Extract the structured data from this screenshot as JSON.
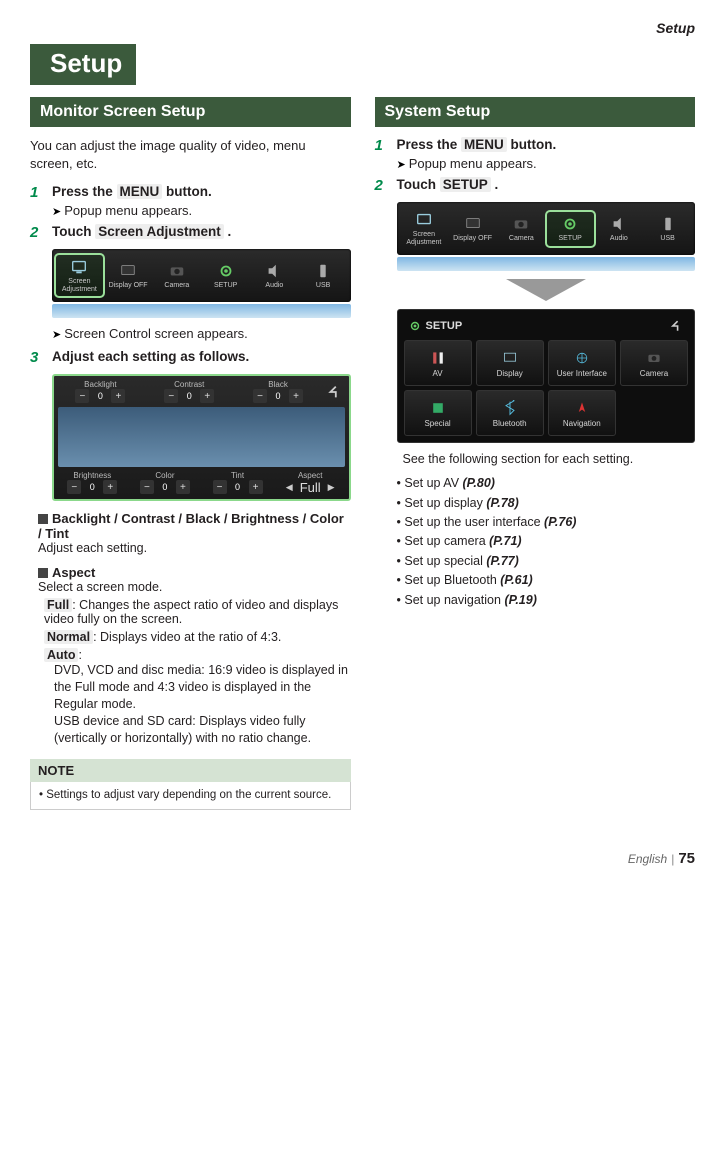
{
  "header": {
    "section": "Setup"
  },
  "title": "Setup",
  "monitor": {
    "heading": "Monitor Screen Setup",
    "intro": "You can adjust the image quality of video, menu screen, etc.",
    "step1": {
      "num": "1",
      "text_a": "Press the ",
      "btn": "MENU",
      "text_b": " button.",
      "sub": "Popup menu appears."
    },
    "step2": {
      "num": "2",
      "text_a": "Touch ",
      "btn": "Screen Adjustment",
      "text_b": " .",
      "sub": "Screen Control screen appears."
    },
    "step3": {
      "num": "3",
      "text": "Adjust each setting as follows."
    },
    "popup_tiles": [
      {
        "label": "Screen Adjustment"
      },
      {
        "label": "Display OFF"
      },
      {
        "label": "Camera"
      },
      {
        "label": "SETUP"
      },
      {
        "label": "Audio"
      },
      {
        "label": "USB"
      }
    ],
    "adjust": {
      "top": [
        {
          "label": "Backlight",
          "val": "0"
        },
        {
          "label": "Contrast",
          "val": "0"
        },
        {
          "label": "Black",
          "val": "0"
        }
      ],
      "bottom": [
        {
          "label": "Brightness",
          "val": "0"
        },
        {
          "label": "Color",
          "val": "0"
        },
        {
          "label": "Tint",
          "val": "0"
        }
      ],
      "aspect_label": "Aspect",
      "aspect_value": "Full"
    },
    "group1": {
      "items": "Backlight / Contrast / Black / Brightness / Color / Tint",
      "desc": "Adjust each setting."
    },
    "group2": {
      "title": "Aspect",
      "desc": "Select a screen mode.",
      "full": {
        "name": "Full",
        "desc": ": Changes the aspect ratio of video and displays video fully on the screen."
      },
      "normal": {
        "name": "Normal",
        "desc": ": Displays video at the ratio of 4:3."
      },
      "auto": {
        "name": "Auto",
        "colon": ":",
        "d1": "DVD, VCD and disc media: 16:9 video is displayed in the Full mode and 4:3 video is displayed in the Regular mode.",
        "d2": "USB device and SD card: Displays video fully (vertically or horizontally) with no ratio change."
      }
    },
    "note": {
      "head": "NOTE",
      "item": "Settings to adjust vary depending on the current source."
    }
  },
  "system": {
    "heading": "System Setup",
    "step1": {
      "num": "1",
      "text_a": "Press the ",
      "btn": "MENU",
      "text_b": " button.",
      "sub": "Popup menu appears."
    },
    "step2": {
      "num": "2",
      "text_a": "Touch ",
      "btn": "SETUP",
      "text_b": " ."
    },
    "popup_tiles": [
      {
        "label": "Screen Adjustment"
      },
      {
        "label": "Display OFF"
      },
      {
        "label": "Camera"
      },
      {
        "label": "SETUP"
      },
      {
        "label": "Audio"
      },
      {
        "label": "USB"
      }
    ],
    "setup_screen": {
      "title": "SETUP",
      "cells": [
        {
          "label": "AV"
        },
        {
          "label": "Display"
        },
        {
          "label": "User Interface"
        },
        {
          "label": "Camera"
        },
        {
          "label": "Special"
        },
        {
          "label": "Bluetooth"
        },
        {
          "label": "Navigation"
        }
      ]
    },
    "after_text": "See the following section for each setting.",
    "list": [
      {
        "t": "Set up AV ",
        "p": "(P.80)"
      },
      {
        "t": "Set up display ",
        "p": "(P.78)"
      },
      {
        "t": "Set up the user interface ",
        "p": "(P.76)"
      },
      {
        "t": "Set up camera ",
        "p": "(P.71)"
      },
      {
        "t": "Set up special ",
        "p": "(P.77)"
      },
      {
        "t": "Set up Bluetooth ",
        "p": "(P.61)"
      },
      {
        "t": "Set up navigation ",
        "p": "(P.19)"
      }
    ]
  },
  "footer": {
    "lang": "English",
    "page": "75"
  }
}
